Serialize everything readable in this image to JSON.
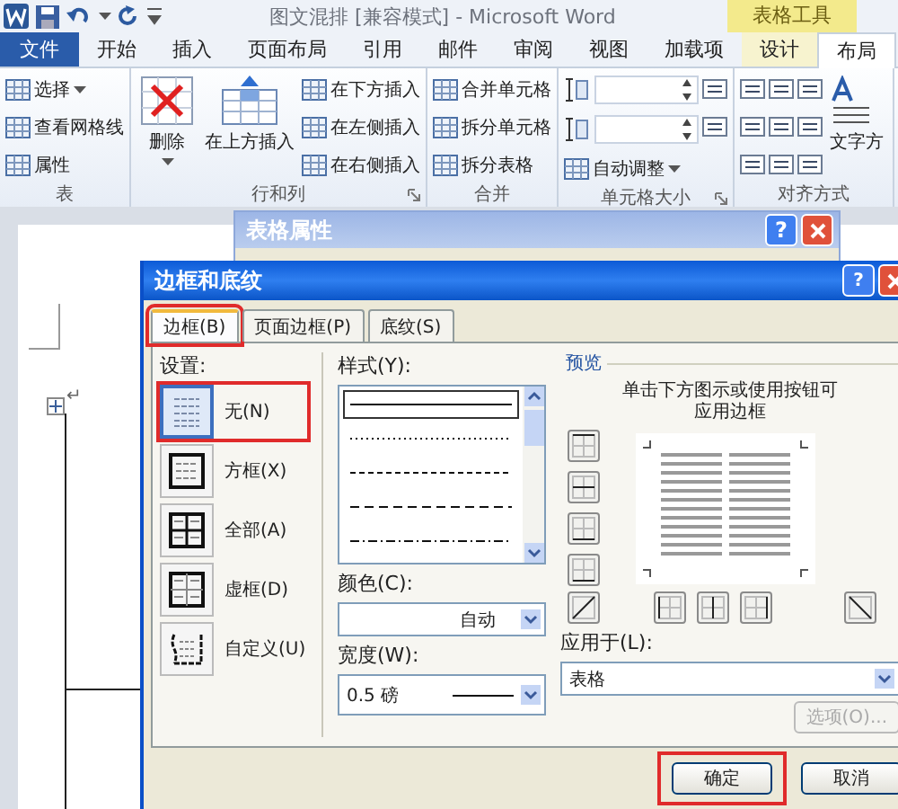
{
  "title_bar": {
    "title": "图文混排 [兼容模式] - Microsoft Word",
    "context_label": "表格工具"
  },
  "tabs": [
    {
      "label": "文件",
      "kind": "file",
      "selected": false
    },
    {
      "label": "开始",
      "kind": "normal",
      "selected": false
    },
    {
      "label": "插入",
      "kind": "normal",
      "selected": false
    },
    {
      "label": "页面布局",
      "kind": "normal",
      "selected": false
    },
    {
      "label": "引用",
      "kind": "normal",
      "selected": false
    },
    {
      "label": "邮件",
      "kind": "normal",
      "selected": false
    },
    {
      "label": "审阅",
      "kind": "normal",
      "selected": false
    },
    {
      "label": "视图",
      "kind": "normal",
      "selected": false
    },
    {
      "label": "加载项",
      "kind": "normal",
      "selected": false
    },
    {
      "label": "设计",
      "kind": "context",
      "selected": false
    },
    {
      "label": "布局",
      "kind": "context",
      "selected": true
    }
  ],
  "ribbon": [
    {
      "label": "表",
      "launcher": false,
      "columns": [
        [
          {
            "label": "选择",
            "kind": "small",
            "dropdown": true
          },
          {
            "label": "查看网格线",
            "kind": "small",
            "dropdown": false
          },
          {
            "label": "属性",
            "kind": "small",
            "dropdown": false
          }
        ]
      ]
    },
    {
      "label": "行和列",
      "launcher": true,
      "columns": [
        [
          {
            "label": "删除",
            "kind": "large-delete",
            "dropdown": true
          }
        ],
        [
          {
            "label": "在上方插入",
            "kind": "large",
            "dropdown": false
          }
        ],
        [
          {
            "label": "在下方插入",
            "kind": "small",
            "dropdown": false
          },
          {
            "label": "在左侧插入",
            "kind": "small",
            "dropdown": false
          },
          {
            "label": "在右侧插入",
            "kind": "small",
            "dropdown": false
          }
        ]
      ]
    },
    {
      "label": "合并",
      "launcher": false,
      "columns": [
        [
          {
            "label": "合并单元格",
            "kind": "small",
            "dropdown": false
          },
          {
            "label": "拆分单元格",
            "kind": "small",
            "dropdown": false
          },
          {
            "label": "拆分表格",
            "kind": "small",
            "dropdown": false
          }
        ]
      ]
    },
    {
      "label": "单元格大小",
      "launcher": true,
      "columns": [
        [
          {
            "kind": "spinner"
          },
          {
            "kind": "spinner"
          },
          {
            "label": "自动调整",
            "kind": "small",
            "dropdown": true
          }
        ],
        [
          {
            "kind": "icon"
          },
          {
            "kind": "icon"
          }
        ]
      ]
    },
    {
      "label": "对齐方式",
      "launcher": false,
      "columns": [
        [
          {
            "kind": "icon"
          },
          {
            "kind": "icon"
          },
          {
            "kind": "icon"
          }
        ],
        [
          {
            "kind": "icon"
          },
          {
            "kind": "icon"
          },
          {
            "kind": "icon"
          }
        ],
        [
          {
            "kind": "icon"
          },
          {
            "kind": "icon"
          },
          {
            "kind": "icon"
          }
        ],
        [
          {
            "label": "文字方",
            "kind": "large-text"
          }
        ]
      ]
    }
  ],
  "document": {
    "paragraph_mark": "↵"
  },
  "back_dialog": {
    "title": "表格属性",
    "help": "?"
  },
  "dialog": {
    "title": "边框和底纹",
    "help": "?",
    "tabs": [
      {
        "label": "边框(B)",
        "selected": true,
        "highlighted": true
      },
      {
        "label": "页面边框(P)",
        "selected": false,
        "highlighted": false
      },
      {
        "label": "底纹(S)",
        "selected": false,
        "highlighted": false
      }
    ],
    "settings": {
      "label": "设置:",
      "options": [
        {
          "label": "无(N)",
          "kind": "none",
          "selected": true,
          "highlighted": true
        },
        {
          "label": "方框(X)",
          "kind": "box",
          "selected": false,
          "highlighted": false
        },
        {
          "label": "全部(A)",
          "kind": "all",
          "selected": false,
          "highlighted": false
        },
        {
          "label": "虚框(D)",
          "kind": "grid",
          "selected": false,
          "highlighted": false
        },
        {
          "label": "自定义(U)",
          "kind": "custom",
          "selected": false,
          "highlighted": false
        }
      ]
    },
    "style": {
      "label": "样式(Y):",
      "line_styles": [
        {
          "kind": "solid",
          "selected": true
        },
        {
          "kind": "dotted",
          "selected": false
        },
        {
          "kind": "dashed",
          "selected": false
        },
        {
          "kind": "dashed-long",
          "selected": false
        },
        {
          "kind": "dash-dot",
          "selected": false
        }
      ]
    },
    "color": {
      "label": "颜色(C):",
      "value": "自动"
    },
    "width": {
      "label": "宽度(W):",
      "value": "0.5 磅"
    },
    "preview": {
      "label": "预览",
      "hint": "单击下方图示或使用按钮可应用边框",
      "apply_label": "应用于(L):",
      "apply_value": "表格",
      "options_button": {
        "label": "选项(O)...",
        "disabled": true
      }
    },
    "buttons": [
      {
        "label": "确定",
        "highlighted": true
      },
      {
        "label": "取消",
        "highlighted": false
      }
    ]
  }
}
